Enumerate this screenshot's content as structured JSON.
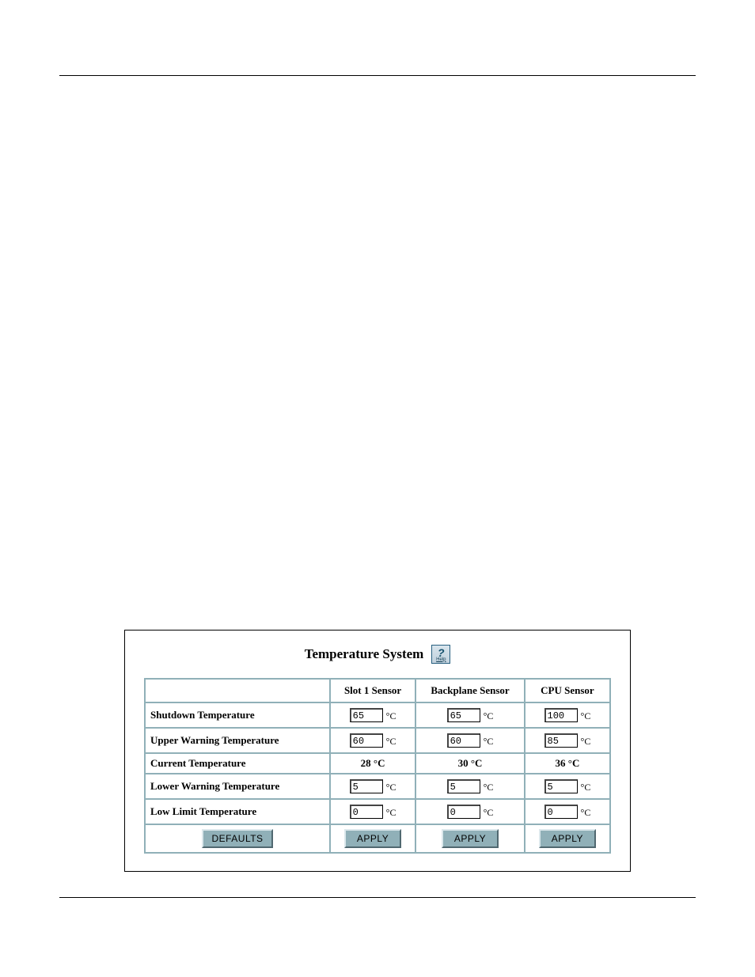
{
  "title": "Temperature System",
  "help": {
    "label": "Help"
  },
  "unit": "°C",
  "columns": {
    "blank": "",
    "slot1": "Slot 1 Sensor",
    "backplane": "Backplane Sensor",
    "cpu": "CPU Sensor"
  },
  "rows": {
    "shutdown": {
      "label": "Shutdown Temperature",
      "slot1": "65",
      "backplane": "65",
      "cpu": "100"
    },
    "upper_warning": {
      "label": "Upper Warning Temperature",
      "slot1": "60",
      "backplane": "60",
      "cpu": "85"
    },
    "current": {
      "label": "Current Temperature",
      "slot1": "28 °C",
      "backplane": "30 °C",
      "cpu": "36 °C"
    },
    "lower_warning": {
      "label": "Lower Warning Temperature",
      "slot1": "5",
      "backplane": "5",
      "cpu": "5"
    },
    "low_limit": {
      "label": "Low Limit Temperature",
      "slot1": "0",
      "backplane": "0",
      "cpu": "0"
    }
  },
  "buttons": {
    "defaults": "DEFAULTS",
    "apply": "APPLY"
  }
}
